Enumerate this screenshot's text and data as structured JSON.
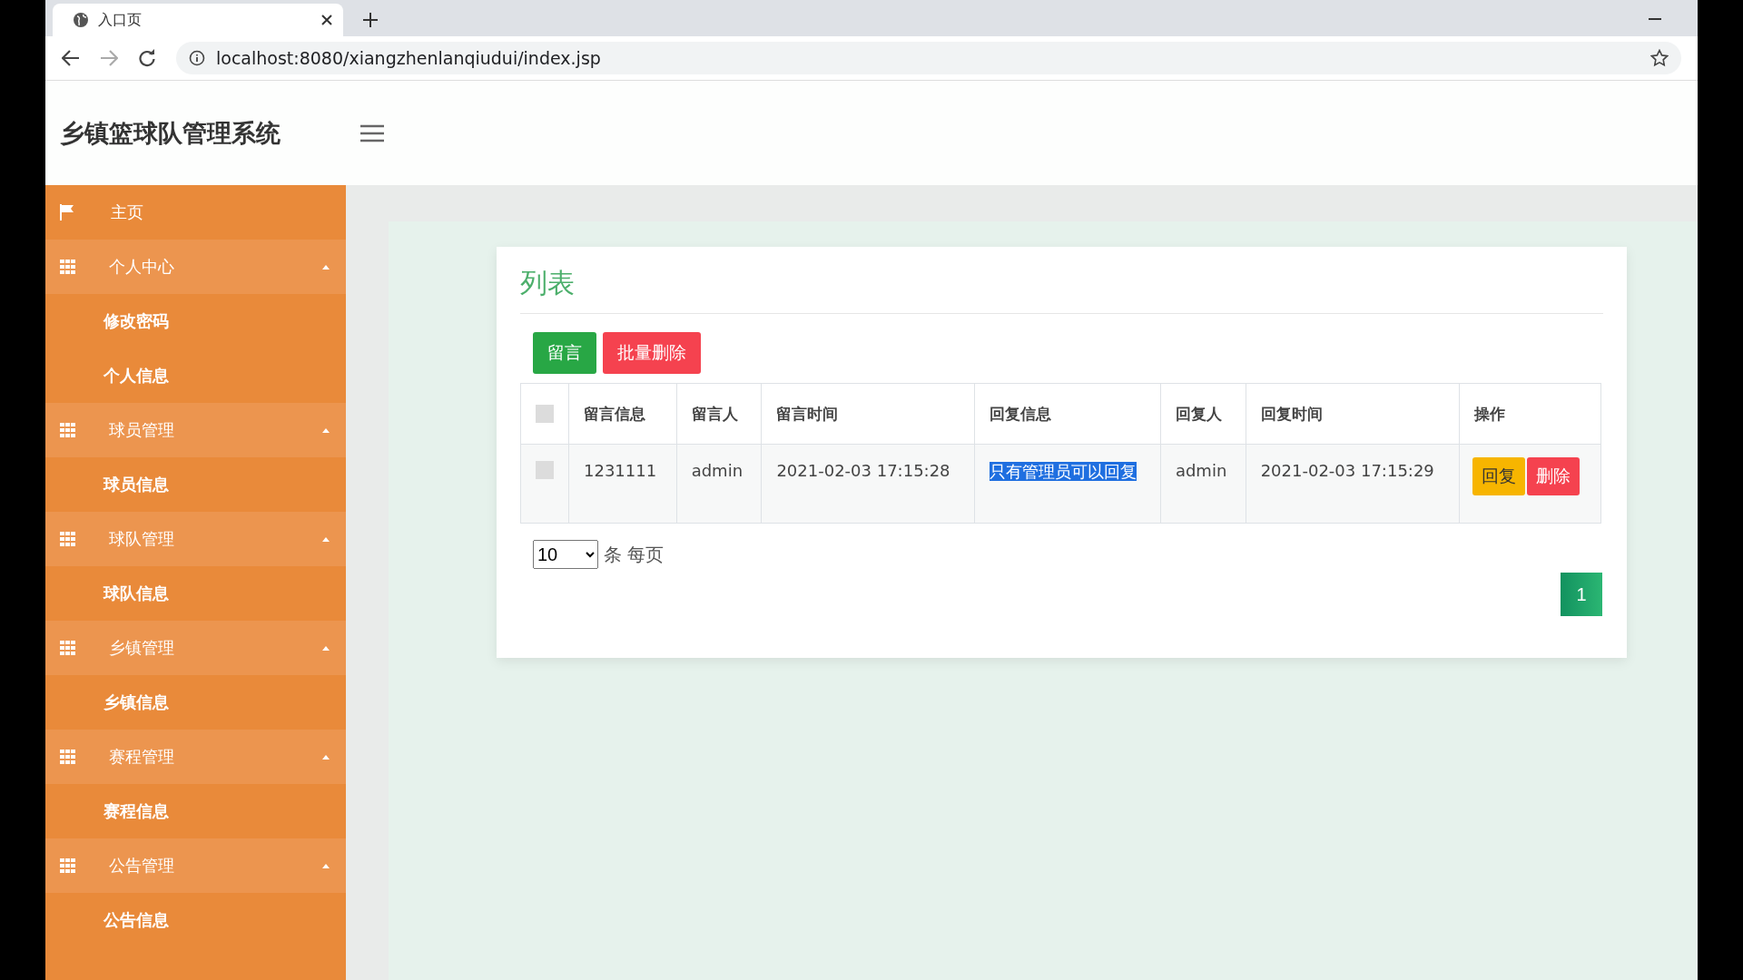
{
  "browser": {
    "tab_title": "入口页",
    "url": "localhost:8080/xiangzhenlanqiudui/index.jsp"
  },
  "app": {
    "title": "乡镇篮球队管理系统"
  },
  "sidebar": {
    "items": [
      {
        "kind": "link",
        "label": "主页"
      },
      {
        "kind": "group",
        "label": "个人中心",
        "expanded": true,
        "children": [
          {
            "label": "修改密码"
          },
          {
            "label": "个人信息"
          }
        ]
      },
      {
        "kind": "group",
        "label": "球员管理",
        "expanded": true,
        "children": [
          {
            "label": "球员信息"
          }
        ]
      },
      {
        "kind": "group",
        "label": "球队管理",
        "expanded": true,
        "children": [
          {
            "label": "球队信息"
          }
        ]
      },
      {
        "kind": "group",
        "label": "乡镇管理",
        "expanded": true,
        "children": [
          {
            "label": "乡镇信息"
          }
        ]
      },
      {
        "kind": "group",
        "label": "赛程管理",
        "expanded": true,
        "children": [
          {
            "label": "赛程信息"
          }
        ]
      },
      {
        "kind": "group",
        "label": "公告管理",
        "expanded": true,
        "children": [
          {
            "label": "公告信息"
          }
        ]
      }
    ]
  },
  "card": {
    "title": "列表",
    "buttons": [
      {
        "label": "留言",
        "kind": "success"
      },
      {
        "label": "批量删除",
        "kind": "danger"
      }
    ],
    "table": {
      "all_checked": false,
      "columns": [
        "留言信息",
        "留言人",
        "留言时间",
        "回复信息",
        "回复人",
        "回复时间",
        "操作"
      ],
      "rows": [
        {
          "checked": false,
          "cells": [
            {
              "text": "1231111",
              "highlighted": false
            },
            {
              "text": "admin",
              "highlighted": false
            },
            {
              "text": "2021-02-03 17:15:28",
              "highlighted": false
            },
            {
              "text": "只有管理员可以回复",
              "highlighted": true
            },
            {
              "text": "admin",
              "highlighted": false
            },
            {
              "text": "2021-02-03 17:15:29",
              "highlighted": false
            }
          ],
          "actions": [
            {
              "label": "回复",
              "kind": "warning"
            },
            {
              "label": "删除",
              "kind": "danger"
            }
          ]
        }
      ]
    },
    "page_size": "10",
    "per_page_label": "条 每页",
    "pages": [
      {
        "label": "1",
        "selected": true
      }
    ]
  }
}
